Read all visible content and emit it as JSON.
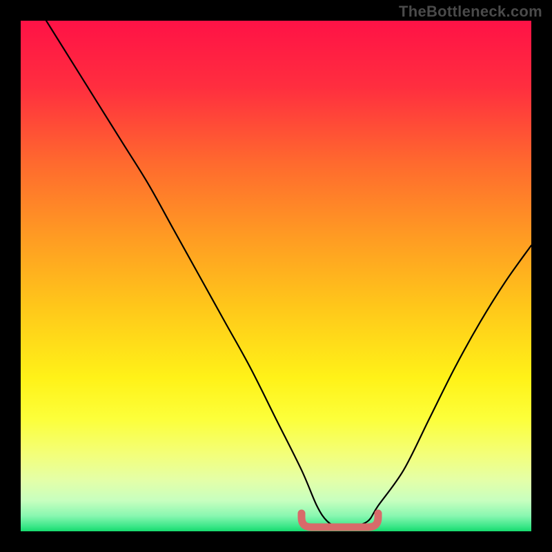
{
  "watermark": "TheBottleneck.com",
  "chart_data": {
    "type": "line",
    "title": "",
    "xlabel": "",
    "ylabel": "",
    "xlim": [
      0,
      100
    ],
    "ylim": [
      0,
      100
    ],
    "grid": false,
    "series": [
      {
        "name": "bottleneck-curve",
        "x": [
          5,
          10,
          15,
          20,
          25,
          30,
          35,
          40,
          45,
          50,
          55,
          58,
          60,
          62,
          65,
          68,
          70,
          75,
          80,
          85,
          90,
          95,
          100
        ],
        "values": [
          100,
          92,
          84,
          76,
          68,
          59,
          50,
          41,
          32,
          22,
          12,
          5,
          2,
          1,
          1,
          2,
          5,
          12,
          22,
          32,
          41,
          49,
          56
        ]
      }
    ],
    "annotations": [
      {
        "name": "optimal-band",
        "shape": "u-marker",
        "x_range": [
          55,
          70
        ],
        "y_level": 0,
        "color": "#d86a6a"
      }
    ],
    "background_gradient": {
      "stops": [
        {
          "offset": 0.0,
          "color": "#ff1246"
        },
        {
          "offset": 0.13,
          "color": "#ff2e3f"
        },
        {
          "offset": 0.28,
          "color": "#ff6a2e"
        },
        {
          "offset": 0.42,
          "color": "#ff9a23"
        },
        {
          "offset": 0.56,
          "color": "#ffc71a"
        },
        {
          "offset": 0.7,
          "color": "#fff218"
        },
        {
          "offset": 0.78,
          "color": "#fcff3a"
        },
        {
          "offset": 0.85,
          "color": "#f3ff7a"
        },
        {
          "offset": 0.9,
          "color": "#e4ffa8"
        },
        {
          "offset": 0.94,
          "color": "#c7ffbf"
        },
        {
          "offset": 0.97,
          "color": "#88f7b0"
        },
        {
          "offset": 0.99,
          "color": "#3de789"
        },
        {
          "offset": 1.0,
          "color": "#16db6e"
        }
      ]
    }
  }
}
